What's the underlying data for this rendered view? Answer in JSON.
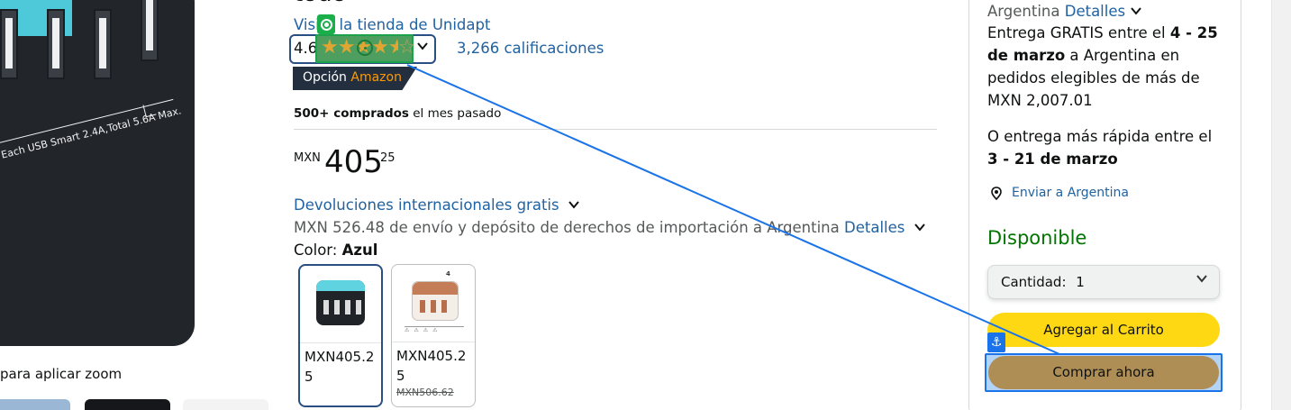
{
  "product": {
    "title_fragment": "todo",
    "store_link": "Visita la tienda de Unidapt",
    "rating_value": "4.6",
    "ratings_count": "3,266 calificaciones",
    "badge_prefix": "Opción",
    "badge_brand": "Amazon",
    "bought_bold": "500+ comprados",
    "bought_rest": "el mes pasado",
    "price_currency": "MXN",
    "price_whole": "405",
    "price_fraction": "25",
    "returns_link": "Devoluciones internacionales gratis",
    "shipping_text": "MXN 526.48 de envío y depósito de derechos de importación a Argentina",
    "shipping_details_link": "Detalles",
    "color_label": "Color:",
    "color_value": "Azul",
    "image_caption": "Each USB Smart 2.4A,Total 5.6A Max.",
    "zoom_hint": "para aplicar zoom",
    "variants": [
      {
        "price": "MXN405.25",
        "selected": true
      },
      {
        "price": "MXN405.25",
        "old_price": "MXN506.62",
        "selected": false
      }
    ]
  },
  "buybox": {
    "country": "Argentina",
    "country_details_link": "Detalles",
    "free_delivery_pre": "Entrega GRATIS entre el",
    "free_delivery_dates": "4 - 25 de marzo",
    "free_delivery_post": "a Argentina en pedidos elegibles de más de MXN 2,007.01",
    "fast_delivery_pre": "O entrega más rápida entre el",
    "fast_delivery_dates": "3 - 21 de marzo",
    "send_to_link": "Enviar a Argentina",
    "availability": "Disponible",
    "quantity_label": "Cantidad:",
    "quantity_value": "1",
    "add_to_cart": "Agregar al Carrito",
    "buy_now": "Comprar ahora"
  },
  "colors": {
    "link": "#2162a1",
    "availability_green": "#007600",
    "cart_yellow": "#ffd814",
    "buy_now_highlight": "#ae8e55",
    "star_gold": "#e0a532",
    "badge_bg": "#232f3e",
    "badge_orange": "#ff9900",
    "annotation_blue": "#1a73e8",
    "annotation_green": "#1aaf4a"
  },
  "annotations": {
    "target_icon": "target-icon",
    "anchor_icon": "anchor-icon"
  }
}
